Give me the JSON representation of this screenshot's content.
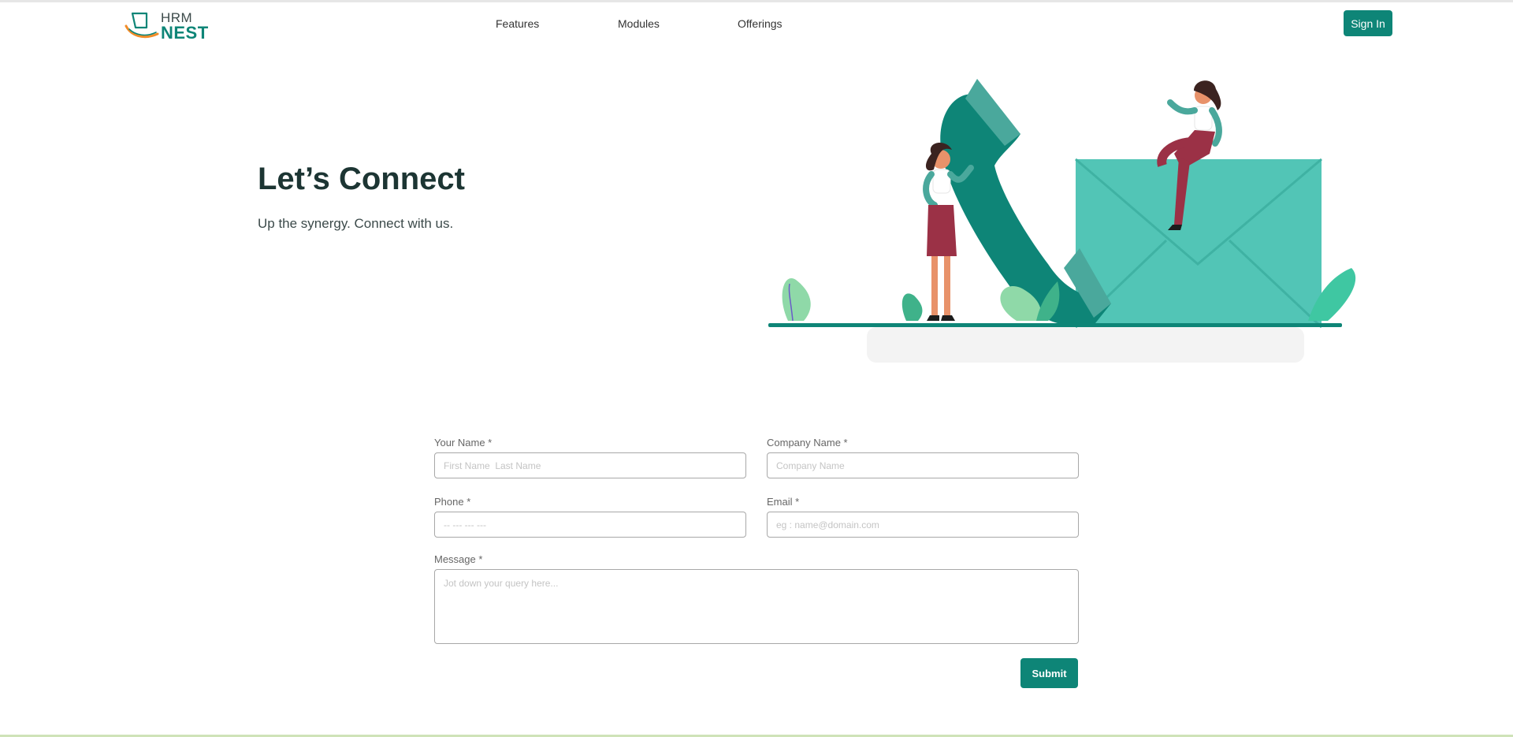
{
  "brand": {
    "logo_top": "HRM",
    "logo_bottom": "NEST",
    "accent": "#0e8577",
    "accent_light": "#52c5b6",
    "ink": "#1c3533"
  },
  "nav": {
    "features": "Features",
    "modules": "Modules",
    "offerings": "Offerings",
    "signin": "Sign In"
  },
  "hero": {
    "title": "Let’s Connect",
    "subtitle": "Up the synergy. Connect with us."
  },
  "form": {
    "name": {
      "label": "Your Name *",
      "placeholder": "First Name  Last Name",
      "value": ""
    },
    "company": {
      "label": "Company Name *",
      "placeholder": "Company Name",
      "value": ""
    },
    "phone": {
      "label": "Phone *",
      "placeholder": "-- --- --- ---",
      "value": ""
    },
    "email": {
      "label": "Email *",
      "placeholder": "eg : name@domain.com",
      "value": ""
    },
    "message": {
      "label": "Message *",
      "placeholder": "Jot down your query here...",
      "value": ""
    },
    "submit": "Submit"
  },
  "icons": {
    "logo": "hrm-nest-logo-icon",
    "illustration": "contact-illustration"
  }
}
